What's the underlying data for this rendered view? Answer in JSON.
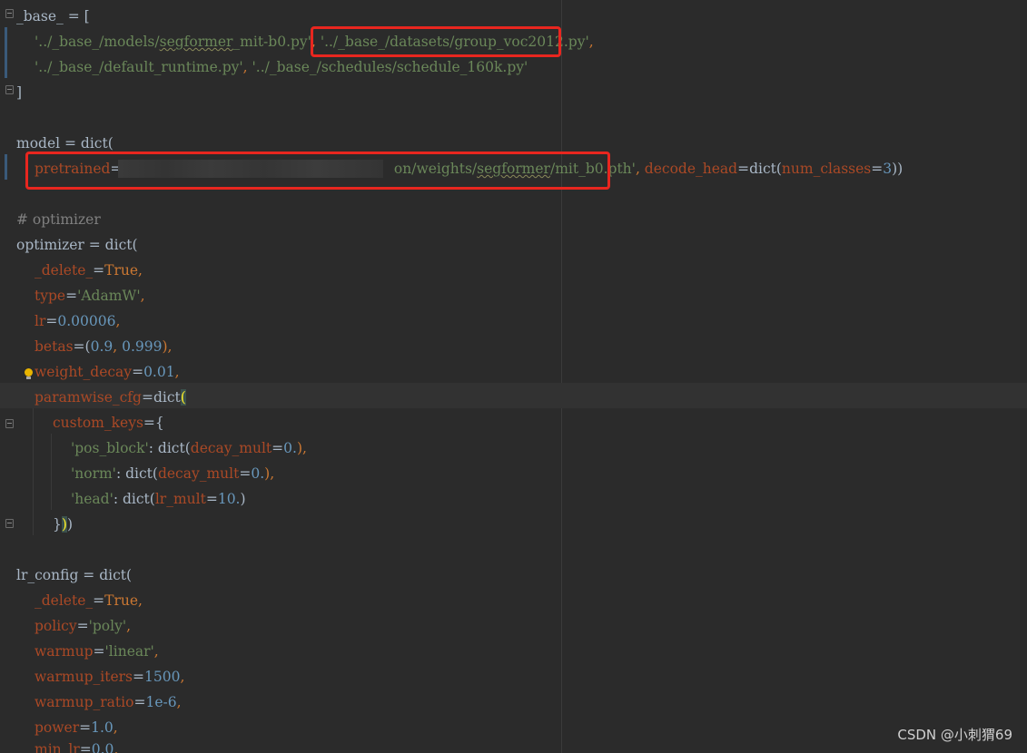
{
  "editor": {
    "lines": {
      "l1": {
        "a": "_base_ = ["
      },
      "l2": {
        "s1": "'../_base_/models/",
        "s1u": "segformer",
        "s1b": "_mit-b0.py'",
        "c1": ", ",
        "s2a": "'../",
        "s2": "_base_/datasets/group_voc2012.py'",
        "c2": ","
      },
      "l3": {
        "s1": "'../_base_/default_runtime.py'",
        "c1": ", ",
        "s2": "'../_base_/schedules/schedule_160k.py'"
      },
      "l4": {
        "a": "]"
      },
      "l6": {
        "a": "model = dict("
      },
      "l7": {
        "p1": "pretrained",
        "eq": "=",
        "s1": "'/",
        "s2": "on/weights/",
        "s2u": "segformer",
        "s3": "/mit_b0.pth'",
        "c1": ", ",
        "p2": "decode_head",
        "eq2": "=dict(",
        "p3": "num_classes",
        "eq3": "=",
        "n1": "3",
        "end": "))"
      },
      "l9": {
        "a": "# optimizer"
      },
      "l10": {
        "a": "optimizer = dict("
      },
      "l11": {
        "p": "_delete_",
        "eq": "=",
        "v": "True",
        "c": ","
      },
      "l12": {
        "p": "type",
        "eq": "=",
        "v": "'AdamW'",
        "c": ","
      },
      "l13": {
        "p": "lr",
        "eq": "=",
        "v": "0.00006",
        "c": ","
      },
      "l14": {
        "p": "betas",
        "eq": "=(",
        "v1": "0.9",
        "c1": ", ",
        "v2": "0.999",
        "c": "),"
      },
      "l15": {
        "p": "weight_decay",
        "eq": "=",
        "v": "0.01",
        "c": ","
      },
      "l16": {
        "p": "paramwise_cfg",
        "eq": "=dict",
        "br": "("
      },
      "l17": {
        "p": "custom_keys",
        "eq": "={"
      },
      "l18": {
        "s": "'pos_block'",
        "c1": ": dict(",
        "p": "decay_mult",
        "eq": "=",
        "v": "0.",
        "c": "),"
      },
      "l19": {
        "s": "'norm'",
        "c1": ": dict(",
        "p": "decay_mult",
        "eq": "=",
        "v": "0.",
        "c": "),"
      },
      "l20": {
        "s": "'head'",
        "c1": ": dict(",
        "p": "lr_mult",
        "eq": "=",
        "v": "10.",
        "c": ")"
      },
      "l21": {
        "a": "}",
        "br": ")",
        "b": ")"
      },
      "l23": {
        "a": "lr_config = dict("
      },
      "l24": {
        "p": "_delete_",
        "eq": "=",
        "v": "True",
        "c": ","
      },
      "l25": {
        "p": "policy",
        "eq": "=",
        "v": "'poly'",
        "c": ","
      },
      "l26": {
        "p": "warmup",
        "eq": "=",
        "v": "'linear'",
        "c": ","
      },
      "l27": {
        "p": "warmup_iters",
        "eq": "=",
        "v": "1500",
        "c": ","
      },
      "l28": {
        "p": "warmup_ratio",
        "eq": "=",
        "v": "1e-6",
        "c": ","
      },
      "l29": {
        "p": "power",
        "eq": "=",
        "v": "1.0",
        "c": ","
      },
      "l30": {
        "p": "min_lr",
        "eq": "=",
        "v": "0.0",
        "c": ","
      }
    }
  },
  "watermark": "CSDN @小刺猬69",
  "colors": {
    "background": "#2b2b2b",
    "highlight_box": "#e8261f",
    "string": "#6a8759",
    "number": "#6897bb",
    "keyword": "#cc7832",
    "parameter": "#aa4926",
    "comment": "#808080"
  }
}
